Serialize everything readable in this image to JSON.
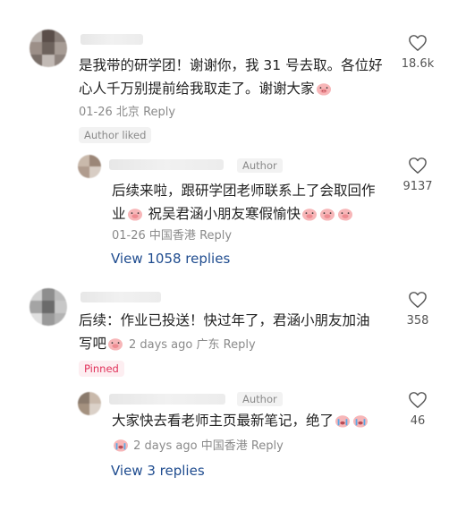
{
  "comments": [
    {
      "text_line1": "是我带的研学团！谢谢你，我 31 号去取。各位好",
      "text_line2": "心人千万别提前给我取走了。谢谢大家",
      "date": "01-26",
      "location": "北京",
      "reply_label": "Reply",
      "likes": "18.6k",
      "badge": "Author liked",
      "reply": {
        "author_tag": "Author",
        "text_line1": "后续来啦，跟研学团老师联系上了会取回作",
        "text_line2": "业",
        "text_line2b": "祝吴君涵小朋友寒假愉快",
        "date": "01-26",
        "location": "中国香港",
        "reply_label": "Reply",
        "likes": "9137"
      },
      "view_replies": "View 1058 replies"
    },
    {
      "text_line1": "后续：作业已投送！快过年了，君涵小朋友加油",
      "text_line2": "写吧",
      "date": "2 days ago",
      "location": "广东",
      "reply_label": "Reply",
      "likes": "358",
      "badge": "Pinned",
      "reply": {
        "author_tag": "Author",
        "text_line1": "大家快去看老师主页最新笔记，绝了",
        "date": "2 days ago",
        "location": "中国香港",
        "reply_label": "Reply",
        "likes": "46"
      },
      "view_replies": "View 3 replies"
    }
  ],
  "icons": {
    "like": "heart-outline-icon",
    "emoji": "pig-face-emoji-icon"
  },
  "colors": {
    "link": "#1f4c8f",
    "pinned": "#e0315a",
    "meta": "#8a8a8a"
  }
}
